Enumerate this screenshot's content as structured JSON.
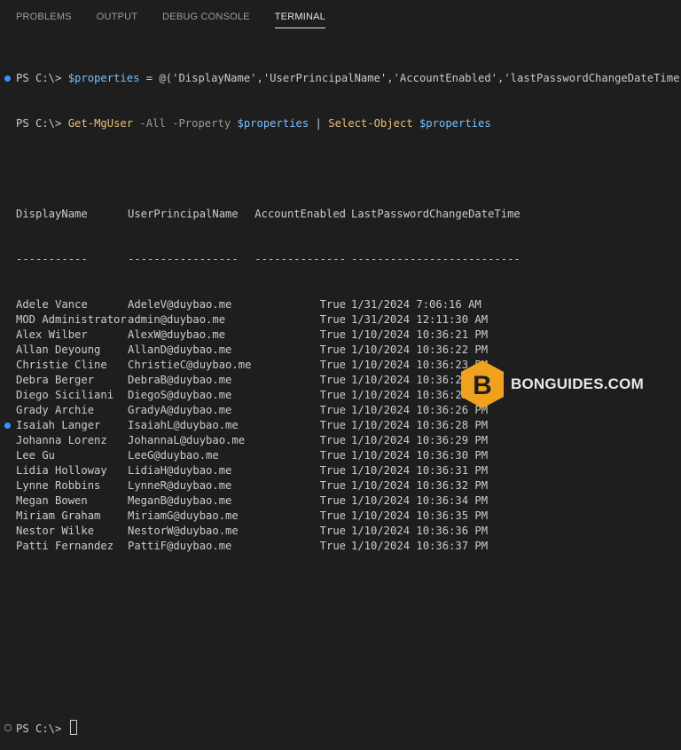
{
  "tabs": [
    "PROBLEMS",
    "OUTPUT",
    "DEBUG CONSOLE",
    "TERMINAL"
  ],
  "active_tab": "TERMINAL",
  "prompt": "PS C:\\>",
  "command1": {
    "var": "$properties",
    "assign": " = @(",
    "items": "'DisplayName','UserPrincipalName','AccountEnabled','lastPasswordChangeDateTime'",
    "close": ")"
  },
  "command2": {
    "cmd": "Get-MgUser",
    "params": " -All -Property ",
    "var": "$properties",
    "pipe": " | ",
    "cmd2": "Select-Object",
    "var2": "$properties"
  },
  "table": {
    "headers": [
      "DisplayName",
      "UserPrincipalName",
      "AccountEnabled",
      "LastPasswordChangeDateTime"
    ],
    "separators": [
      "-----------",
      "-----------------",
      "--------------",
      "--------------------------"
    ],
    "rows": [
      [
        "Adele Vance",
        "AdeleV@duybao.me",
        "True",
        "1/31/2024 7:06:16 AM"
      ],
      [
        "MOD Administrator",
        "admin@duybao.me",
        "True",
        "1/31/2024 12:11:30 AM"
      ],
      [
        "Alex Wilber",
        "AlexW@duybao.me",
        "True",
        "1/10/2024 10:36:21 PM"
      ],
      [
        "Allan Deyoung",
        "AllanD@duybao.me",
        "True",
        "1/10/2024 10:36:22 PM"
      ],
      [
        "Christie Cline",
        "ChristieC@duybao.me",
        "True",
        "1/10/2024 10:36:23 PM"
      ],
      [
        "Debra Berger",
        "DebraB@duybao.me",
        "True",
        "1/10/2024 10:36:24 PM"
      ],
      [
        "Diego Siciliani",
        "DiegoS@duybao.me",
        "True",
        "1/10/2024 10:36:25 PM"
      ],
      [
        "Grady Archie",
        "GradyA@duybao.me",
        "True",
        "1/10/2024 10:36:26 PM"
      ],
      [
        "Isaiah Langer",
        "IsaiahL@duybao.me",
        "True",
        "1/10/2024 10:36:28 PM"
      ],
      [
        "Johanna Lorenz",
        "JohannaL@duybao.me",
        "True",
        "1/10/2024 10:36:29 PM"
      ],
      [
        "Lee Gu",
        "LeeG@duybao.me",
        "True",
        "1/10/2024 10:36:30 PM"
      ],
      [
        "Lidia Holloway",
        "LidiaH@duybao.me",
        "True",
        "1/10/2024 10:36:31 PM"
      ],
      [
        "Lynne Robbins",
        "LynneR@duybao.me",
        "True",
        "1/10/2024 10:36:32 PM"
      ],
      [
        "Megan Bowen",
        "MeganB@duybao.me",
        "True",
        "1/10/2024 10:36:34 PM"
      ],
      [
        "Miriam Graham",
        "MiriamG@duybao.me",
        "True",
        "1/10/2024 10:36:35 PM"
      ],
      [
        "Nestor Wilke",
        "NestorW@duybao.me",
        "True",
        "1/10/2024 10:36:36 PM"
      ],
      [
        "Patti Fernandez",
        "PattiF@duybao.me",
        "True",
        "1/10/2024 10:36:37 PM"
      ]
    ]
  },
  "watermark": "BONGUIDES.COM",
  "logo_letter": "B",
  "colors": {
    "background": "#1e1e1e",
    "text": "#cccccc",
    "variable": "#79c0ff",
    "command": "#e6c07b",
    "status_dot": "#3794ff",
    "logo_orange": "#f0a21e"
  }
}
